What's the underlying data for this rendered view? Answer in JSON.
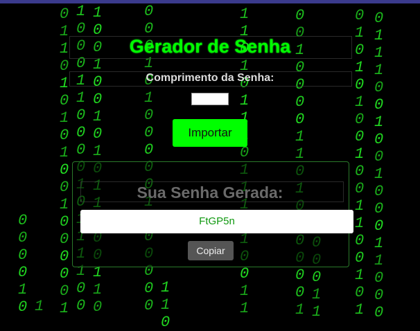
{
  "app": {
    "title": "Gerador de Senha",
    "length_label": "Comprimento da Senha:",
    "length_value": "",
    "generate_button": "Importar",
    "result_title": "Sua Senha Gerada:",
    "generated_password": "FtGP5n",
    "copy_button": "Copiar"
  },
  "background": {
    "style": "matrix-digital-rain",
    "glyphs": [
      "0",
      "1"
    ],
    "color": "#22dd22"
  },
  "colors": {
    "accent": "#00ff00",
    "background": "#000000",
    "topbar": "#3a3a8c",
    "copy_button": "#555555"
  }
}
